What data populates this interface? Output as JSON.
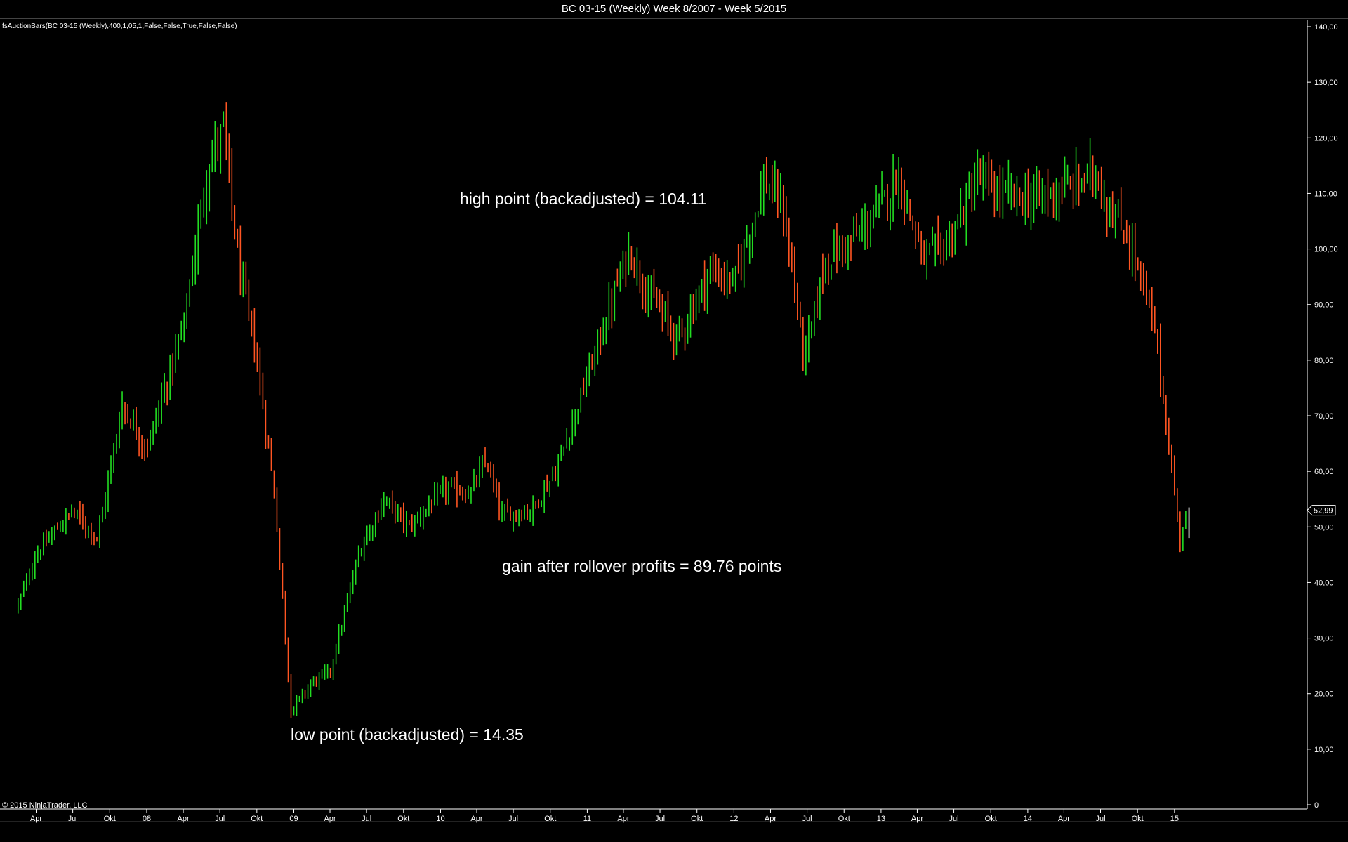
{
  "window": {
    "title": "BC 03-15 (Weekly)  Week 8/2007 - Week 5/2015"
  },
  "indicator_label": "fsAuctionBars(BC 03-15 (Weekly),400,1,05,1,False,False,True,False,False)",
  "copyright": "© 2015 NinjaTrader, LLC",
  "colors": {
    "background": "#000000",
    "up_bar": "#22dd22",
    "down_bar": "#ff5522",
    "axis": "#ffffff",
    "last_price_box": "#ffffff"
  },
  "chart_data": {
    "type": "bar",
    "subtype": "ohlc-weekly",
    "title": "BC 03-15 (Weekly)  Week 8/2007 - Week 5/2015",
    "x_ticks": [
      "Apr",
      "Jul",
      "Okt",
      "08",
      "Apr",
      "Jul",
      "Okt",
      "09",
      "Apr",
      "Jul",
      "Okt",
      "10",
      "Apr",
      "Jul",
      "Okt",
      "11",
      "Apr",
      "Jul",
      "Okt",
      "12",
      "Apr",
      "Jul",
      "Okt",
      "13",
      "Apr",
      "Jul",
      "Okt",
      "14",
      "Apr",
      "Jul",
      "Okt",
      "15"
    ],
    "y_ticks": [
      "140,00",
      "130,00",
      "120,00",
      "110,00",
      "100,00",
      "90,00",
      "80,00",
      "70,00",
      "60,00",
      "50,00",
      "40,00",
      "30,00",
      "20,00",
      "10,00",
      "0"
    ],
    "ylim": [
      0,
      140
    ],
    "grid": false,
    "last_price": "52,99",
    "path_anchors": [
      {
        "date": "2007-02-15",
        "close": 36
      },
      {
        "date": "2007-04-01",
        "close": 45
      },
      {
        "date": "2007-07-01",
        "close": 53
      },
      {
        "date": "2007-09-01",
        "close": 48
      },
      {
        "date": "2007-11-01",
        "close": 72
      },
      {
        "date": "2008-01-01",
        "close": 64
      },
      {
        "date": "2008-04-01",
        "close": 86
      },
      {
        "date": "2008-06-01",
        "close": 115
      },
      {
        "date": "2008-07-10",
        "close": 122
      },
      {
        "date": "2008-08-15",
        "close": 98
      },
      {
        "date": "2008-10-01",
        "close": 80
      },
      {
        "date": "2008-11-15",
        "close": 55
      },
      {
        "date": "2008-12-25",
        "close": 17
      },
      {
        "date": "2009-02-15",
        "close": 22
      },
      {
        "date": "2009-04-01",
        "close": 24
      },
      {
        "date": "2009-06-15",
        "close": 46
      },
      {
        "date": "2009-08-15",
        "close": 55
      },
      {
        "date": "2009-10-15",
        "close": 50
      },
      {
        "date": "2010-01-15",
        "close": 57
      },
      {
        "date": "2010-03-15",
        "close": 56
      },
      {
        "date": "2010-04-25",
        "close": 62
      },
      {
        "date": "2010-06-01",
        "close": 52
      },
      {
        "date": "2010-08-15",
        "close": 53
      },
      {
        "date": "2010-10-15",
        "close": 60
      },
      {
        "date": "2011-01-01",
        "close": 77
      },
      {
        "date": "2011-04-15",
        "close": 100
      },
      {
        "date": "2011-06-01",
        "close": 92
      },
      {
        "date": "2011-08-15",
        "close": 84
      },
      {
        "date": "2011-11-01",
        "close": 96
      },
      {
        "date": "2012-01-01",
        "close": 94
      },
      {
        "date": "2012-03-15",
        "close": 112
      },
      {
        "date": "2012-05-01",
        "close": 108
      },
      {
        "date": "2012-06-25",
        "close": 80
      },
      {
        "date": "2012-08-15",
        "close": 98
      },
      {
        "date": "2012-11-15",
        "close": 103
      },
      {
        "date": "2013-02-15",
        "close": 113
      },
      {
        "date": "2013-04-15",
        "close": 98
      },
      {
        "date": "2013-06-15",
        "close": 101
      },
      {
        "date": "2013-08-01",
        "close": 108
      },
      {
        "date": "2013-09-01",
        "close": 113
      },
      {
        "date": "2013-10-15",
        "close": 110
      },
      {
        "date": "2014-01-01",
        "close": 109
      },
      {
        "date": "2014-04-15",
        "close": 111
      },
      {
        "date": "2014-06-20",
        "close": 114
      },
      {
        "date": "2014-07-15",
        "close": 108
      },
      {
        "date": "2014-09-15",
        "close": 101
      },
      {
        "date": "2014-11-15",
        "close": 85
      },
      {
        "date": "2014-12-15",
        "close": 66
      },
      {
        "date": "2015-01-15",
        "close": 48
      },
      {
        "date": "2015-02-01",
        "close": 52.99
      }
    ],
    "annotations": [
      {
        "text": "high point (backadjusted) = 104.11"
      },
      {
        "text": "gain after rollover profits = 89.76 points"
      },
      {
        "text": "low point (backadjusted) = 14.35"
      }
    ]
  }
}
